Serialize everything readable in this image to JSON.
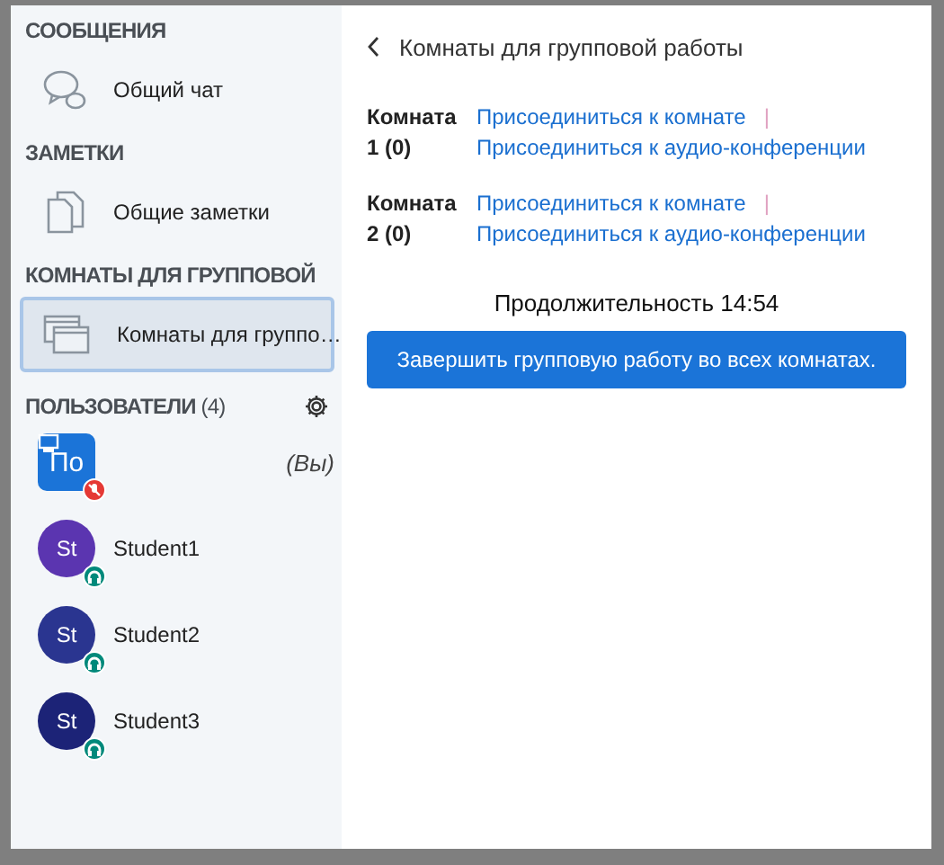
{
  "sidebar": {
    "sections": [
      {
        "heading": "СООБЩЕНИЯ",
        "items": [
          {
            "kind": "chat",
            "label": "Общий чат",
            "selected": false
          }
        ]
      },
      {
        "heading": "ЗАМЕТКИ",
        "items": [
          {
            "kind": "notes",
            "label": "Общие заметки",
            "selected": false
          }
        ]
      },
      {
        "heading": "КОМНАТЫ ДЛЯ ГРУППОВОЙ",
        "items": [
          {
            "kind": "rooms",
            "label": "Комнаты для группо…",
            "selected": true
          }
        ]
      }
    ],
    "users": {
      "heading": "ПОЛЬЗОВАТЕЛИ",
      "count": "(4)",
      "list": [
        {
          "kind": "self",
          "initials": "По",
          "tag": "(Вы)",
          "color": "#1b74d8",
          "presenter": true,
          "muted": true,
          "listen_only": false
        },
        {
          "kind": "student",
          "initials": "St",
          "name": "Student1",
          "color": "#5b35b0",
          "presenter": false,
          "muted": false,
          "listen_only": true
        },
        {
          "kind": "student",
          "initials": "St",
          "name": "Student2",
          "color": "#2a3590",
          "presenter": false,
          "muted": false,
          "listen_only": true
        },
        {
          "kind": "student",
          "initials": "St",
          "name": "Student3",
          "color": "#1c2377",
          "presenter": false,
          "muted": false,
          "listen_only": true
        }
      ]
    }
  },
  "main": {
    "title": "Комнаты для групповой работы",
    "rooms": [
      {
        "name": "Комната 1 (0)",
        "join": "Присоединиться к комнате",
        "separator": "|",
        "audio": "Присоединиться к аудио-конференции"
      },
      {
        "name": "Комната 2 (0)",
        "join": "Присоединиться к комнате",
        "separator": "|",
        "audio": "Присоединиться к аудио-конференции"
      }
    ],
    "duration": "Продолжительность 14:54",
    "end_button": "Завершить групповую работу во всех комнатах."
  }
}
